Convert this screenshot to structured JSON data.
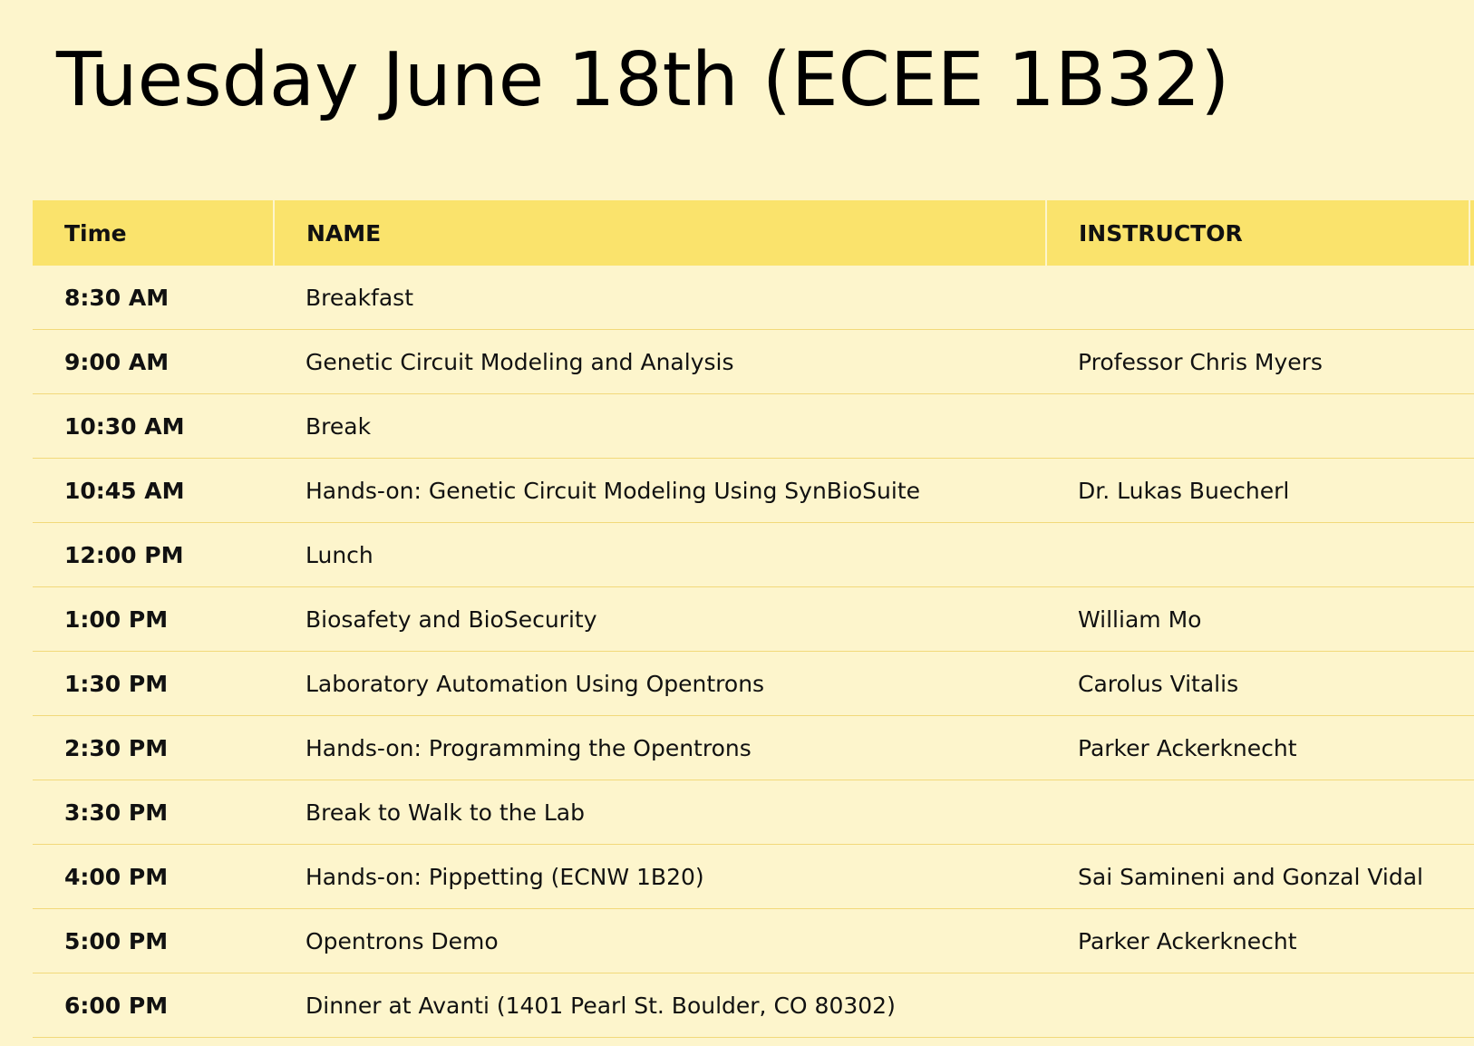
{
  "page": {
    "title": "Tuesday June 18th (ECEE 1B32)"
  },
  "table": {
    "headers": {
      "time": "Time",
      "name": "NAME",
      "instructor": "INSTRUCTOR"
    },
    "rows": [
      {
        "time": "8:30 AM",
        "name": "Breakfast",
        "instructor": ""
      },
      {
        "time": "9:00 AM",
        "name": "Genetic Circuit Modeling and Analysis",
        "instructor": "Professor Chris Myers"
      },
      {
        "time": "10:30 AM",
        "name": "Break",
        "instructor": ""
      },
      {
        "time": "10:45 AM",
        "name": "Hands-on: Genetic Circuit Modeling Using SynBioSuite",
        "instructor": "Dr. Lukas Buecherl"
      },
      {
        "time": "12:00 PM",
        "name": "Lunch",
        "instructor": ""
      },
      {
        "time": "1:00 PM",
        "name": "Biosafety and BioSecurity",
        "instructor": "William Mo"
      },
      {
        "time": "1:30 PM",
        "name": "Laboratory Automation Using Opentrons",
        "instructor": "Carolus Vitalis"
      },
      {
        "time": "2:30 PM",
        "name": "Hands-on: Programming the Opentrons",
        "instructor": "Parker Ackerknecht"
      },
      {
        "time": "3:30 PM",
        "name": "Break to Walk to the Lab",
        "instructor": ""
      },
      {
        "time": "4:00 PM",
        "name": "Hands-on: Pippetting (ECNW 1B20)",
        "instructor": "Sai Samineni and Gonzal Vidal"
      },
      {
        "time": "5:00 PM",
        "name": "Opentrons Demo",
        "instructor": "Parker Ackerknecht"
      },
      {
        "time": "6:00 PM",
        "name": "Dinner at Avanti (1401 Pearl St. Boulder, CO 80302)",
        "instructor": ""
      }
    ]
  },
  "colors": {
    "page_background": "#fdf5cc",
    "header_background": "#fae36c",
    "row_divider": "#f2d97a",
    "text": "#111111"
  }
}
